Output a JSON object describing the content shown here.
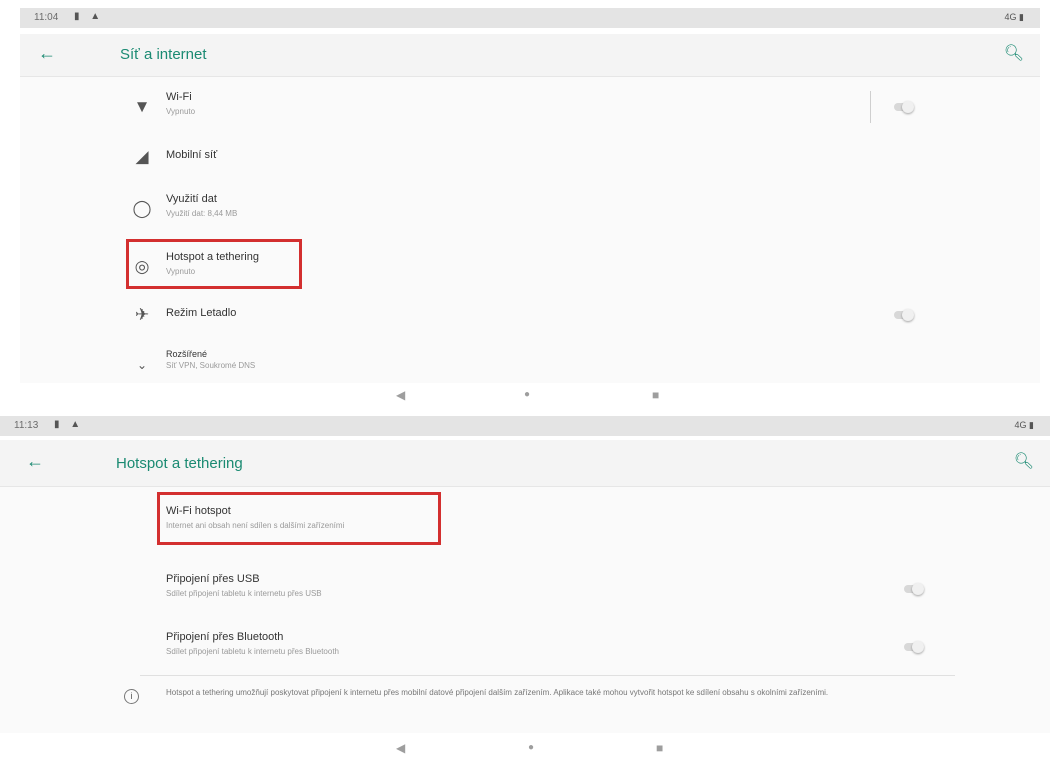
{
  "screen1": {
    "status": {
      "time": "11:04",
      "icons": "▮ ▲",
      "right": "4G ▮"
    },
    "appbar": {
      "title": "Síť a internet"
    },
    "items": [
      {
        "label": "Wi-Fi",
        "sub": "Vypnuto"
      },
      {
        "label": "Mobilní síť",
        "sub": ""
      },
      {
        "label": "Využití dat",
        "sub": "Využití dat: 8,44 MB"
      },
      {
        "label": "Hotspot a tethering",
        "sub": "Vypnuto"
      },
      {
        "label": "Režim Letadlo",
        "sub": ""
      },
      {
        "label": "Rozšířené",
        "sub": "Síť VPN, Soukromé DNS"
      }
    ]
  },
  "screen2": {
    "status": {
      "time": "11:13",
      "icons": "▮ ▲",
      "right": "4G ▮"
    },
    "appbar": {
      "title": "Hotspot a tethering"
    },
    "items": [
      {
        "label": "Wi-Fi hotspot",
        "sub": "Internet ani obsah není sdílen s dalšími zařízeními"
      },
      {
        "label": "Připojení přes USB",
        "sub": "Sdílet připojení tabletu k internetu přes USB"
      },
      {
        "label": "Připojení přes Bluetooth",
        "sub": "Sdílet připojení tabletu k internetu přes Bluetooth"
      }
    ],
    "info": "Hotspot a tethering umožňují poskytovat připojení k internetu přes mobilní datové připojení dalším zařízením. Aplikace také mohou vytvořit hotspot ke sdílení obsahu s okolními zařízeními."
  },
  "nav": {
    "back": "◀",
    "home": "●",
    "recents": "■"
  },
  "colors": {
    "accent": "#1a8a72",
    "highlight": "#d32f2f"
  }
}
